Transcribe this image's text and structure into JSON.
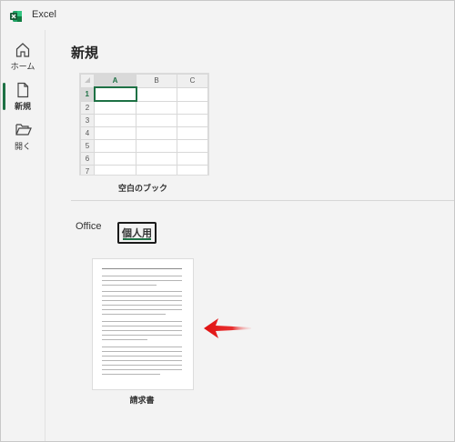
{
  "app": {
    "title": "Excel",
    "brand_color": "#1e7145"
  },
  "sidebar": {
    "items": [
      {
        "label": "ホーム",
        "icon": "home-icon"
      },
      {
        "label": "新規",
        "icon": "new-document-icon",
        "active": true
      },
      {
        "label": "開く",
        "icon": "folder-open-icon"
      }
    ]
  },
  "main": {
    "heading": "新規",
    "blank_template": {
      "label": "空白のブック",
      "columns": [
        "A",
        "B",
        "C"
      ],
      "rows": [
        "1",
        "2",
        "3",
        "4",
        "5",
        "6",
        "7"
      ]
    },
    "tabs": [
      {
        "label": "Office"
      },
      {
        "label": "個人用",
        "active": true
      }
    ],
    "personal_templates": [
      {
        "label": "請求書"
      }
    ]
  }
}
